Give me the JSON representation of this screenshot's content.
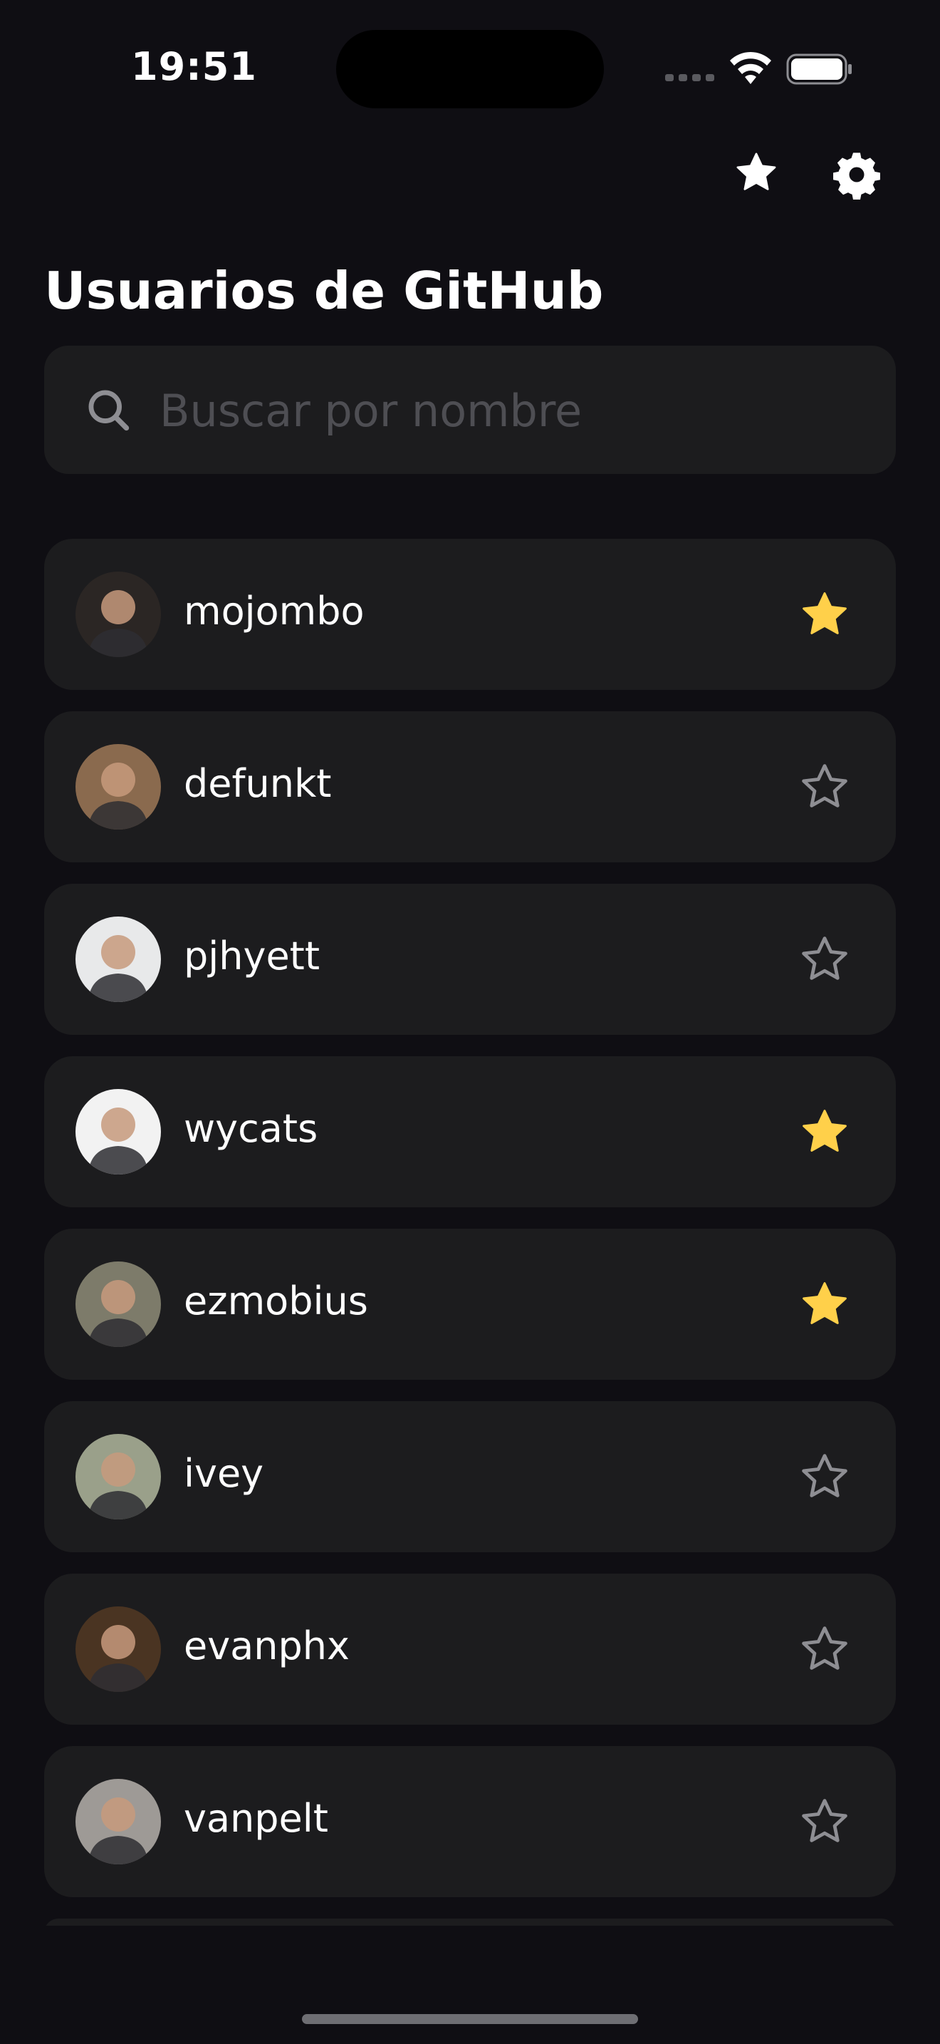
{
  "status_bar": {
    "time": "19:51"
  },
  "header": {
    "favorites_icon": "star-icon",
    "settings_icon": "gear-icon"
  },
  "page_title": "Usuarios de GitHub",
  "search": {
    "placeholder": "Buscar por nombre",
    "value": "",
    "icon": "search-icon"
  },
  "users": [
    {
      "username": "mojombo",
      "favorite": true,
      "avatar_tone": "#2b2624"
    },
    {
      "username": "defunkt",
      "favorite": false,
      "avatar_tone": "#8a6a4e"
    },
    {
      "username": "pjhyett",
      "favorite": false,
      "avatar_tone": "#e8e9ea"
    },
    {
      "username": "wycats",
      "favorite": true,
      "avatar_tone": "#f2f2f2"
    },
    {
      "username": "ezmobius",
      "favorite": true,
      "avatar_tone": "#7d7b6a"
    },
    {
      "username": "ivey",
      "favorite": false,
      "avatar_tone": "#9aa08a"
    },
    {
      "username": "evanphx",
      "favorite": false,
      "avatar_tone": "#4a3422"
    },
    {
      "username": "vanpelt",
      "favorite": false,
      "avatar_tone": "#9e9a96"
    }
  ],
  "colors": {
    "background": "#0f0e13",
    "card": "#1c1c1e",
    "favorite_star": "#ffd04a",
    "empty_star": "#8e8e93",
    "placeholder": "#4e4e53"
  }
}
